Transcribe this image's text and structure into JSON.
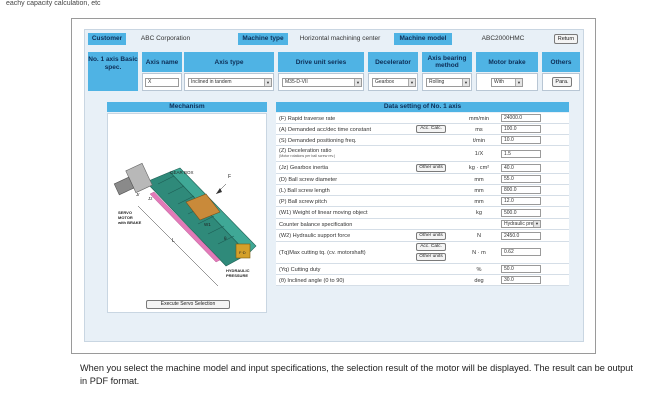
{
  "top_note": "eachy capacity calculation, etc",
  "header": {
    "customer_label": "Customer",
    "customer_value": "ABC Corporation",
    "machine_type_label": "Machine type",
    "machine_type_value": "Horizontal machining center",
    "machine_model_label": "Machine model",
    "machine_model_value": "ABC2000HMC",
    "return_button": "Return"
  },
  "spec": {
    "row_label": "No. 1 axis Basic spec.",
    "columns": [
      {
        "header": "Axis name",
        "value": "X"
      },
      {
        "header": "Axis type",
        "value": "Inclined in tandem"
      },
      {
        "header": "Drive unit series",
        "value": "M35-D-VII"
      },
      {
        "header": "Decelerator",
        "value": "Gearbox"
      },
      {
        "header": "Axis bearing method",
        "value": "Rolling"
      },
      {
        "header": "Motor brake",
        "value": "With"
      },
      {
        "header": "Others",
        "value": "Para."
      }
    ]
  },
  "mechanism": {
    "title": "Mechanism",
    "labels": {
      "gear_box": "GEAR BOX",
      "servo_motor": "SERVO MOTOR with BRAKE",
      "hydraulic": "HYDRAULIC PRESSURE",
      "jr": "Jr",
      "jz": "Jz",
      "f": "F",
      "l": "L",
      "w1": "W1",
      "theta": "θ",
      "fd": "F·D"
    },
    "execute_button": "Execute Servo Selection"
  },
  "settings": {
    "title": "Data setting of No. 1 axis",
    "rows": [
      {
        "label": "(F) Rapid traverse rate",
        "unit": "mm/min",
        "value": "24000.0"
      },
      {
        "label": "(A) Demanded acc/dec time constant",
        "button": "Acc. Calc.",
        "unit": "ms",
        "value": "100.0"
      },
      {
        "label": "(S) Demanded positioning freq.",
        "unit": "t/min",
        "value": "10.0"
      },
      {
        "label": "(Z) Deceleration ratio",
        "sublabel": "(Motor rotations per ball screw rev.)",
        "unit": "1/X",
        "value": "1.5"
      },
      {
        "label": "(Jz) Gearbox inertia",
        "button": "Other units",
        "unit": "kg · cm²",
        "value": "40.0"
      },
      {
        "label": "(D) Ball screw diameter",
        "unit": "mm",
        "value": "55.0"
      },
      {
        "label": "(L) Ball screw length",
        "unit": "mm",
        "value": "800.0"
      },
      {
        "label": "(P) Ball screw pitch",
        "unit": "mm",
        "value": "12.0"
      },
      {
        "label": "(W1) Weight of linear moving object",
        "unit": "kg",
        "value": "500.0"
      },
      {
        "label": "Counter balance specification",
        "unit": "",
        "value": "Hydraulic pres."
      },
      {
        "label": "(W2) Hydraulic support force",
        "button": "Other units",
        "unit": "N",
        "value": "2450.0"
      },
      {
        "label": "(Tq)Max cutting tq. (cv. motorshaft)",
        "button": "Acc. Calc.",
        "button2": "Other units",
        "unit": "N · m",
        "value": "0.62"
      },
      {
        "label": "(Yq) Cutting duty",
        "unit": "%",
        "value": "50.0"
      },
      {
        "label": "(θ) Inclined angle (0 to 90)",
        "unit": "deg",
        "value": "30.0"
      }
    ]
  },
  "caption": "When you select the machine model and input specifications, the selection result of the motor will be displayed. The result can be output in PDF format."
}
